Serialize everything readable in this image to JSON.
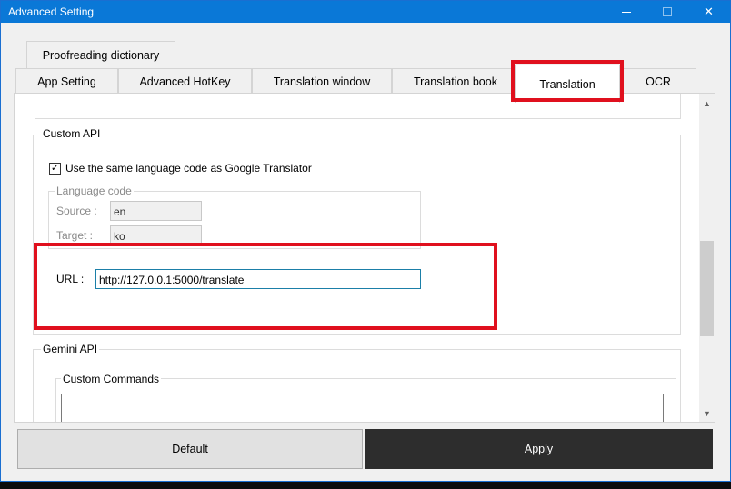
{
  "window": {
    "title": "Advanced Setting",
    "controls": [
      "minimize-icon",
      "maximize-icon",
      "close-icon"
    ]
  },
  "tabs": {
    "row1": [
      "Proofreading dictionary"
    ],
    "row2": [
      "App Setting",
      "Advanced HotKey",
      "Translation window",
      "Translation book",
      "Translation",
      "OCR"
    ],
    "active": "Translation"
  },
  "custom_api": {
    "label": "Custom API",
    "same_lang_checkbox": {
      "label": "Use the same language code as Google Translator",
      "checked": true
    },
    "language_code": {
      "label": "Language code",
      "source_label": "Source :",
      "source_value": "en",
      "target_label": "Target :",
      "target_value": "ko"
    },
    "url": {
      "label": "URL :",
      "value": "http://127.0.0.1:5000/translate"
    }
  },
  "gemini_api": {
    "label": "Gemini API",
    "custom_commands_label": "Custom Commands"
  },
  "buttons": {
    "default_label": "Default",
    "apply_label": "Apply"
  },
  "colors": {
    "titlebar": "#0a78d7",
    "highlight": "#e0101e",
    "apply_bg": "#2d2d2d"
  }
}
